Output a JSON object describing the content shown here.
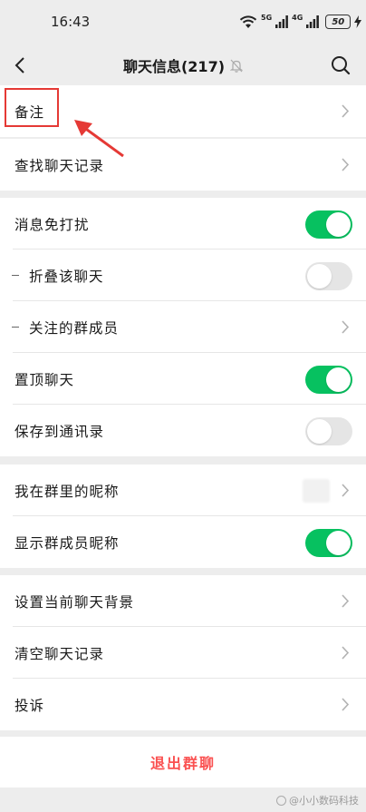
{
  "status_bar": {
    "time": "16:43",
    "wifi_icon": "wifi-icon",
    "net_5g": "5G",
    "net_4g": "4G",
    "battery": "50"
  },
  "nav": {
    "back_icon": "back-arrow-icon",
    "title": "聊天信息(217)",
    "mute_icon": "bell-muted-icon",
    "search_icon": "search-icon"
  },
  "sections": {
    "remark": {
      "label": "备注"
    },
    "search_history": {
      "label": "查找聊天记录"
    },
    "mute": {
      "label": "消息免打扰",
      "on": true
    },
    "fold": {
      "label": "折叠该聊天",
      "on": false
    },
    "follow_members": {
      "label": "关注的群成员"
    },
    "pin": {
      "label": "置顶聊天",
      "on": true
    },
    "save_contacts": {
      "label": "保存到通讯录",
      "on": false
    },
    "my_nickname": {
      "label": "我在群里的昵称"
    },
    "show_nicknames": {
      "label": "显示群成员昵称",
      "on": true
    },
    "set_background": {
      "label": "设置当前聊天背景"
    },
    "clear_history": {
      "label": "清空聊天记录"
    },
    "complain": {
      "label": "投诉"
    }
  },
  "exit": {
    "label": "退出群聊"
  },
  "watermark": {
    "text": "@小小数码科技"
  },
  "colors": {
    "toggle_on": "#07c160",
    "toggle_off": "#e5e5e5",
    "exit_red": "#fa5151",
    "annotation_red": "#e53935"
  }
}
